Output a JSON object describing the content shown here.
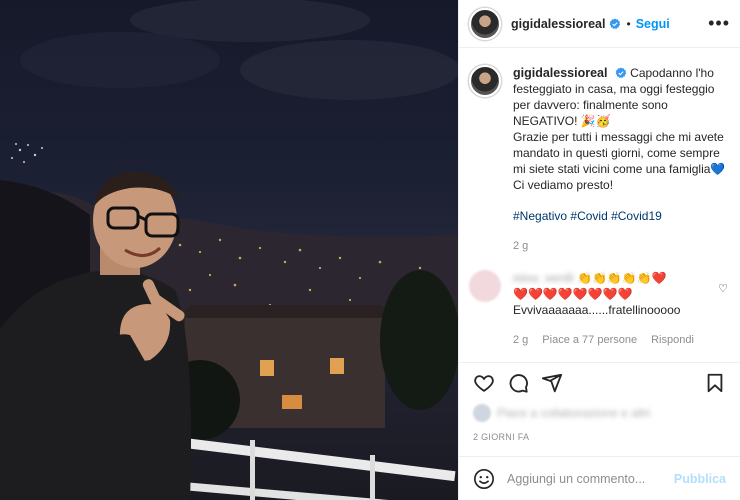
{
  "header": {
    "username": "gigidalessioreal",
    "separator": "•",
    "follow_label": "Segui",
    "more_label": "•••"
  },
  "caption": {
    "username": "gigidalessioreal",
    "line1": "Capodanno l'ho festeggiato in casa, ma oggi festeggio per davvero: finalmente sono NEGATIVO! 🎉🥳",
    "line2": "Grazie per tutti i messaggi che mi avete mandato in questi giorni, come sempre mi siete stati vicini come una famiglia💙",
    "line3": "Ci vediamo presto!",
    "hashtags": [
      "#Negativo",
      "#Covid",
      "#Covid19"
    ],
    "time": "2 g"
  },
  "comment": {
    "username": "nino_verdi",
    "emojis": "👏👏👏👏👏❤️",
    "hearts": "❤️❤️❤️❤️❤️❤️❤️❤️",
    "text": "Evvivaaaaaaa......fratellinooooo",
    "time": "2 g",
    "likes": "Piace a 77 persone",
    "reply": "Rispondi",
    "like_icon": "♡"
  },
  "likes_line": "Piace a collaborazione e altri",
  "date_label": "2 GIORNI FA",
  "add_comment": {
    "placeholder": "Aggiungi un commento...",
    "publish_label": "Pubblica"
  },
  "icons": [
    "heart-icon",
    "comment-icon",
    "share-icon",
    "bookmark-icon",
    "emoji-icon",
    "verified-icon"
  ],
  "colors": {
    "accent": "#0095f6",
    "verified": "#3897f0",
    "link": "#00376b",
    "muted": "#8e8e8e",
    "publish_disabled": "#b2dffc"
  }
}
